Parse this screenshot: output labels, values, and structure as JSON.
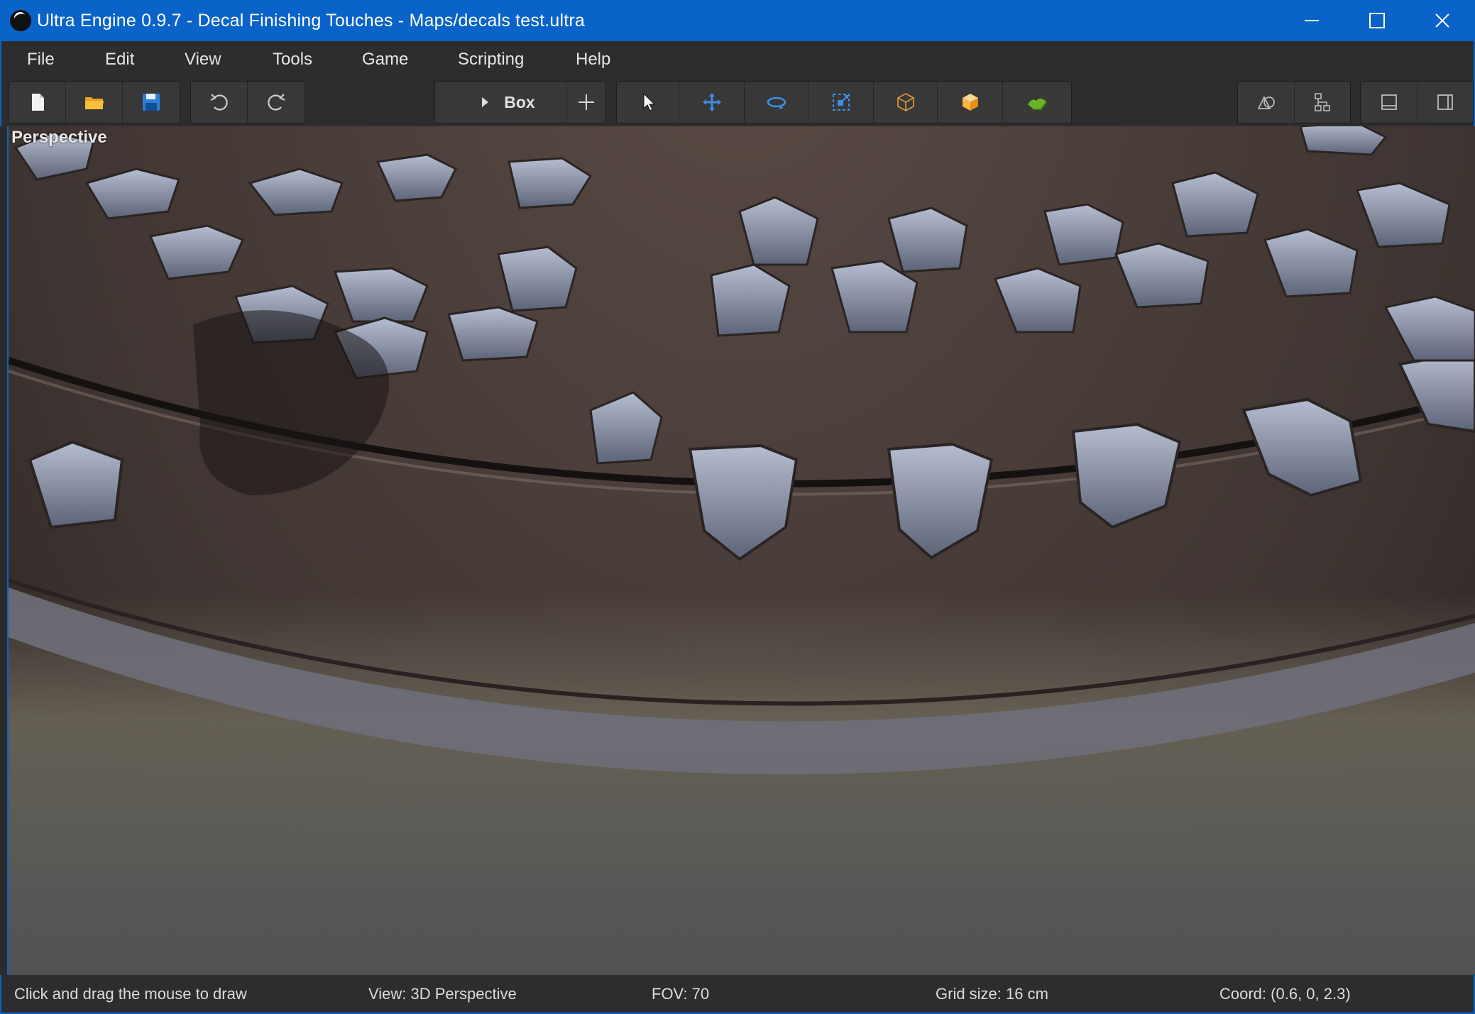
{
  "window": {
    "title": "Ultra Engine 0.9.7 - Decal Finishing Touches - Maps/decals test.ultra",
    "accent": "#0a63c9"
  },
  "menu": {
    "items": [
      "File",
      "Edit",
      "View",
      "Tools",
      "Game",
      "Scripting",
      "Help"
    ]
  },
  "toolbar": {
    "primitive_dropdown": "Box",
    "icons": {
      "file": [
        "new-file-icon",
        "open-folder-icon",
        "save-icon"
      ],
      "history": [
        "undo-icon",
        "redo-icon"
      ],
      "create": [
        "play-icon",
        "add-icon"
      ],
      "transform": [
        "select-cursor-icon",
        "move-icon",
        "rotate-icon",
        "scale-icon",
        "wireframe-box-icon",
        "solid-box-icon",
        "terrain-icon"
      ],
      "panels": [
        "shapes-icon",
        "hierarchy-icon",
        "bottom-panel-icon",
        "side-panel-icon"
      ]
    }
  },
  "viewport": {
    "label": "Perspective"
  },
  "status": {
    "hint": "Click and drag the mouse to draw",
    "view": "View: 3D Perspective",
    "fov": "FOV: 70",
    "grid": "Grid size: 16 cm",
    "coord": "Coord: (0.6, 0, 2.3)"
  }
}
